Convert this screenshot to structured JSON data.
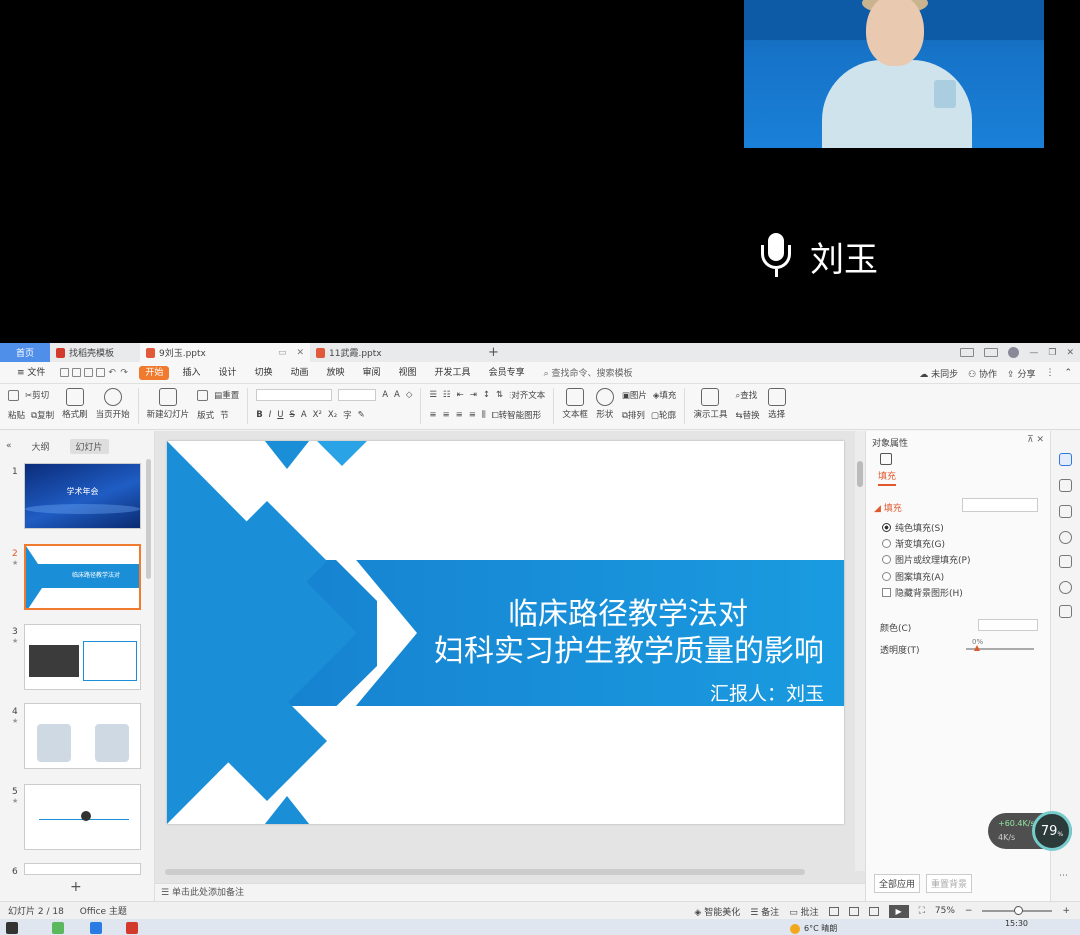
{
  "meeting": {
    "speaker_name": "刘玉"
  },
  "tabs": {
    "home": "首页",
    "template": "找稻壳模板",
    "file1": "9刘玉.pptx",
    "file2": "11武霞.pptx",
    "add": "+"
  },
  "menu": {
    "file": "文件",
    "items": [
      "开始",
      "插入",
      "设计",
      "切换",
      "动画",
      "放映",
      "审阅",
      "视图",
      "开发工具",
      "会员专享"
    ],
    "search": "查找命令、搜索模板",
    "sync": "未同步",
    "collab": "协作",
    "share": "分享"
  },
  "ribbon": {
    "paste": "粘贴",
    "cut": "剪切",
    "copy": "复制",
    "format_painter": "格式刷",
    "from_current": "当页开始",
    "new_slide": "新建幻灯片",
    "layout": "版式",
    "section": "节",
    "reset": "重置",
    "bold": "B",
    "italic": "I",
    "underline": "U",
    "strike": "S",
    "align_text": "对齐文本",
    "smart_shape": "转智能图形",
    "textbox": "文本框",
    "shape": "形状",
    "arrange": "排列",
    "picture": "图片",
    "fill": "填充",
    "outline": "轮廓",
    "presenter_tools": "演示工具",
    "find": "查找",
    "replace": "替换",
    "select": "选择"
  },
  "thumbs": {
    "outline_tab": "大纲",
    "slides_tab": "幻灯片",
    "items": [
      {
        "num": "1",
        "title": "学术年会"
      },
      {
        "num": "2",
        "title": "临床路径教学法对"
      },
      {
        "num": "3",
        "title": ""
      },
      {
        "num": "4",
        "title": ""
      },
      {
        "num": "5",
        "title": ""
      },
      {
        "num": "6",
        "title": ""
      }
    ],
    "add": "+"
  },
  "slide": {
    "title_line1": "临床路径教学法对",
    "title_line2": "妇科实习护生教学质量的影响",
    "reporter": "汇报人：刘玉",
    "colors": {
      "primary": "#1a8fd8",
      "light": "#35a9ea"
    }
  },
  "notes": {
    "placeholder": "单击此处添加备注"
  },
  "props": {
    "title": "对象属性",
    "fill_tab": "填充",
    "section": "填充",
    "options": [
      {
        "label": "纯色填充(S)",
        "type": "radio",
        "checked": true
      },
      {
        "label": "渐变填充(G)",
        "type": "radio",
        "checked": false
      },
      {
        "label": "图片或纹理填充(P)",
        "type": "radio",
        "checked": false
      },
      {
        "label": "图案填充(A)",
        "type": "radio",
        "checked": false
      },
      {
        "label": "隐藏背景图形(H)",
        "type": "checkbox",
        "checked": false
      }
    ],
    "color_label": "颜色(C)",
    "transparency_label": "透明度(T)",
    "transparency_value": "0%",
    "apply_all": "全部应用",
    "reset_bg": "重置背景"
  },
  "speed": {
    "up": "+60.4K/s",
    "down": "4K/s",
    "percent": "79",
    "unit": "%"
  },
  "status": {
    "slide": "幻灯片 2 / 18",
    "theme": "Office 主题",
    "beautify": "智能美化",
    "notes": "备注",
    "comment": "批注",
    "zoom": "75%"
  },
  "taskbar": {
    "weather": "6°C 晴朗",
    "time": "15:30"
  }
}
